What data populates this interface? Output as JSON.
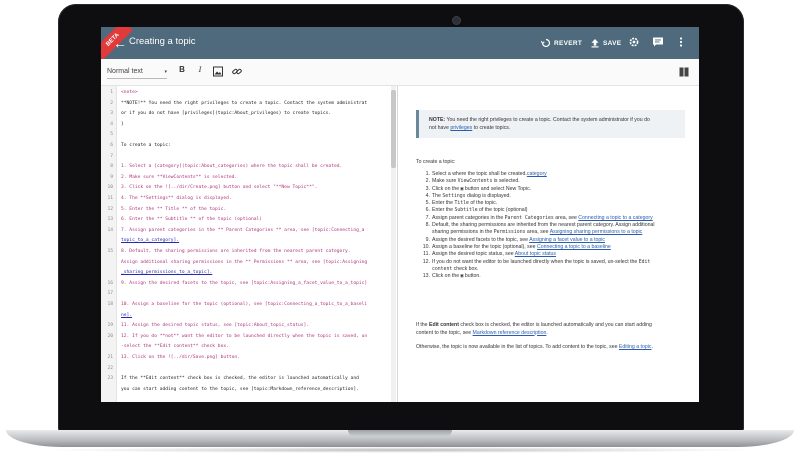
{
  "app": {
    "badge": "BETA",
    "title": "Creating a topic"
  },
  "header_actions": {
    "revert_label": "REVERT",
    "save_label": "SAVE"
  },
  "toolbar": {
    "style_value": "Normal text",
    "bold": "B",
    "italic": "I"
  },
  "editor_lines": [
    {
      "num": "1",
      "code": "<note>",
      "kind": "tag"
    },
    {
      "num": "2",
      "code": "**NOTE!** You need the right privileges to create a topic. Contact the system administrat",
      "kind": "key"
    },
    {
      "num": "3",
      "code": "or if you do not have [privileges](topic:About_privileges) to create topics.",
      "kind": "key"
    },
    {
      "num": "4",
      "code": "}",
      "kind": "key"
    },
    {
      "num": "5",
      "code": "",
      "kind": "key"
    },
    {
      "num": "6",
      "code": "To create a topic:",
      "kind": "key"
    },
    {
      "num": "7",
      "code": "",
      "kind": "key"
    },
    {
      "num": "8",
      "code": "1. Select a [category](topic:About_categories) where the topic shall be created.",
      "kind": "pink"
    },
    {
      "num": "9",
      "code": "2. Make sure **ViewContents** is selected.",
      "kind": "pink"
    },
    {
      "num": "10",
      "code": "3. Click on the ![../dir/Create.png] button and select \"**New Topic**\".",
      "kind": "pink"
    },
    {
      "num": "11",
      "code": "4. The **Settings** dialog is displayed.",
      "kind": "pink"
    },
    {
      "num": "12",
      "code": "5. Enter the ** Title ** of the topic.",
      "kind": "pink"
    },
    {
      "num": "13",
      "code": "6. Enter the ** Subtitle ** of the topic (optional)",
      "kind": "pink"
    },
    {
      "num": "14",
      "code": "7. Assign parent categories in the ** Parent Categories ** area, see [topic:Connecting_a",
      "kind": "pink"
    },
    {
      "num": "",
      "code": "topic_to_a_category].",
      "kind": "link"
    },
    {
      "num": "15",
      "code": "8. Default, the sharing permissions are inherited from the nearest parent category.",
      "kind": "pink"
    },
    {
      "num": "",
      "code": "Assign additional sharing permissions in the ** Permissions ** area, see [topic:Assigning",
      "kind": "pink"
    },
    {
      "num": "",
      "code": "_sharing_permissions_to_a_topic].",
      "kind": "link"
    },
    {
      "num": "16",
      "code": "9. Assign the desired facets to the topic, see [topic:Assigning_a_facet_value_to_a_topic]",
      "kind": "pink"
    },
    {
      "num": "17",
      "code": "",
      "kind": "key"
    },
    {
      "num": "18",
      "code": "10. Assign a baseline for the topic (optional), see [topic:Connecting_a_topic_to_a_baseli",
      "kind": "pink"
    },
    {
      "num": "",
      "code": "ne].",
      "kind": "link"
    },
    {
      "num": "19",
      "code": "11. Assign the desired topic status, see [topic:About_topic_status].",
      "kind": "pink"
    },
    {
      "num": "20",
      "code": "12. If you do **not** want the editor to be launched directly when the topic is saved, un",
      "kind": "pink"
    },
    {
      "num": "",
      "code": "-select the **Edit content** check box.",
      "kind": "pink"
    },
    {
      "num": "21",
      "code": "13. Click on the ![../dir/Save.png] button.",
      "kind": "pink"
    },
    {
      "num": "22",
      "code": "",
      "kind": "key"
    },
    {
      "num": "23",
      "code": "If the **Edit content** check box is checked, the editor is launched automatically and",
      "kind": "key"
    },
    {
      "num": "",
      "code": "you can start adding content to the topic, see [topic:Markdown_reference_description].",
      "kind": "key"
    }
  ],
  "preview": {
    "note_bold": "NOTE:",
    "note_text_1": " You need the right privileges to create a topic. Contact the system administrator if you do",
    "note_text_2a": "not have ",
    "note_link": "privileges",
    "note_text_2b": " to create topics.",
    "intro": "To create a topic:",
    "steps": [
      {
        "n": "1.",
        "pre": "Select a ",
        "mono": "",
        "link": "category",
        "post": " where the topic shall be created."
      },
      {
        "n": "2.",
        "pre": "Make sure ",
        "mono": "ViewContents",
        "link": "",
        "post": " is selected."
      },
      {
        "n": "3.",
        "pre": "Click on the ",
        "mono": "▣",
        "link": "",
        "post": " button and select New Topic."
      },
      {
        "n": "4.",
        "pre": "The ",
        "mono": "Settings",
        "link": "",
        "post": " dialog is displayed."
      },
      {
        "n": "5.",
        "pre": "Enter the ",
        "mono": "Title",
        "link": "",
        "post": " of the topic."
      },
      {
        "n": "6.",
        "pre": "Enter the ",
        "mono": "Subtitle",
        "link": "",
        "post": " of the topic (optional)"
      },
      {
        "n": "7.",
        "pre": "Assign parent categories in the ",
        "mono": "Parent Categories",
        "link": "Connecting a topic to a category",
        "post": " area, see "
      },
      {
        "n": "8.",
        "pre": "Default, the sharing permissions are inherited from the nearest parent category. Assign additional",
        "mono": "",
        "link": "",
        "post": ""
      },
      {
        "n": "",
        "pre": "sharing permissions in the ",
        "mono": "Permissions",
        "link": "Assigning sharing permissions to a topic",
        "post": " area, see "
      },
      {
        "n": "9.",
        "pre": "Assign the desired facets to the topic, see ",
        "mono": "",
        "link": "Assigning a facet value to a topic",
        "post": ""
      },
      {
        "n": "10.",
        "pre": "Assign a baseline for the topic (optional), see ",
        "mono": "",
        "link": "Connecting a topic to a baseline",
        "post": ""
      },
      {
        "n": "11.",
        "pre": "Assign the desired topic status, see ",
        "mono": "",
        "link": "About topic status",
        "post": ""
      },
      {
        "n": "12.",
        "pre": "If you do not want the editor to be launched directly when the topic is saved, un-select the ",
        "mono": "Edit",
        "link": "",
        "post": ""
      },
      {
        "n": "",
        "pre": "",
        "mono": "content",
        "link": "",
        "post": " check box."
      },
      {
        "n": "13.",
        "pre": "Click on the ",
        "mono": "▣",
        "link": "",
        "post": " button."
      }
    ],
    "para1_a": "If the ",
    "para1_bold": "Edit content",
    "para1_b": " check box is checked, the editor is launched automatically and you can start adding",
    "para1_c": "content to the topic, see ",
    "para1_link": "Markdown reference description",
    "para1_d": ".",
    "para2_a": "Otherwise, the topic is now available in the list of topics. To add content to the topic, see ",
    "para2_link": "Editing a topic",
    "para2_b": "."
  }
}
